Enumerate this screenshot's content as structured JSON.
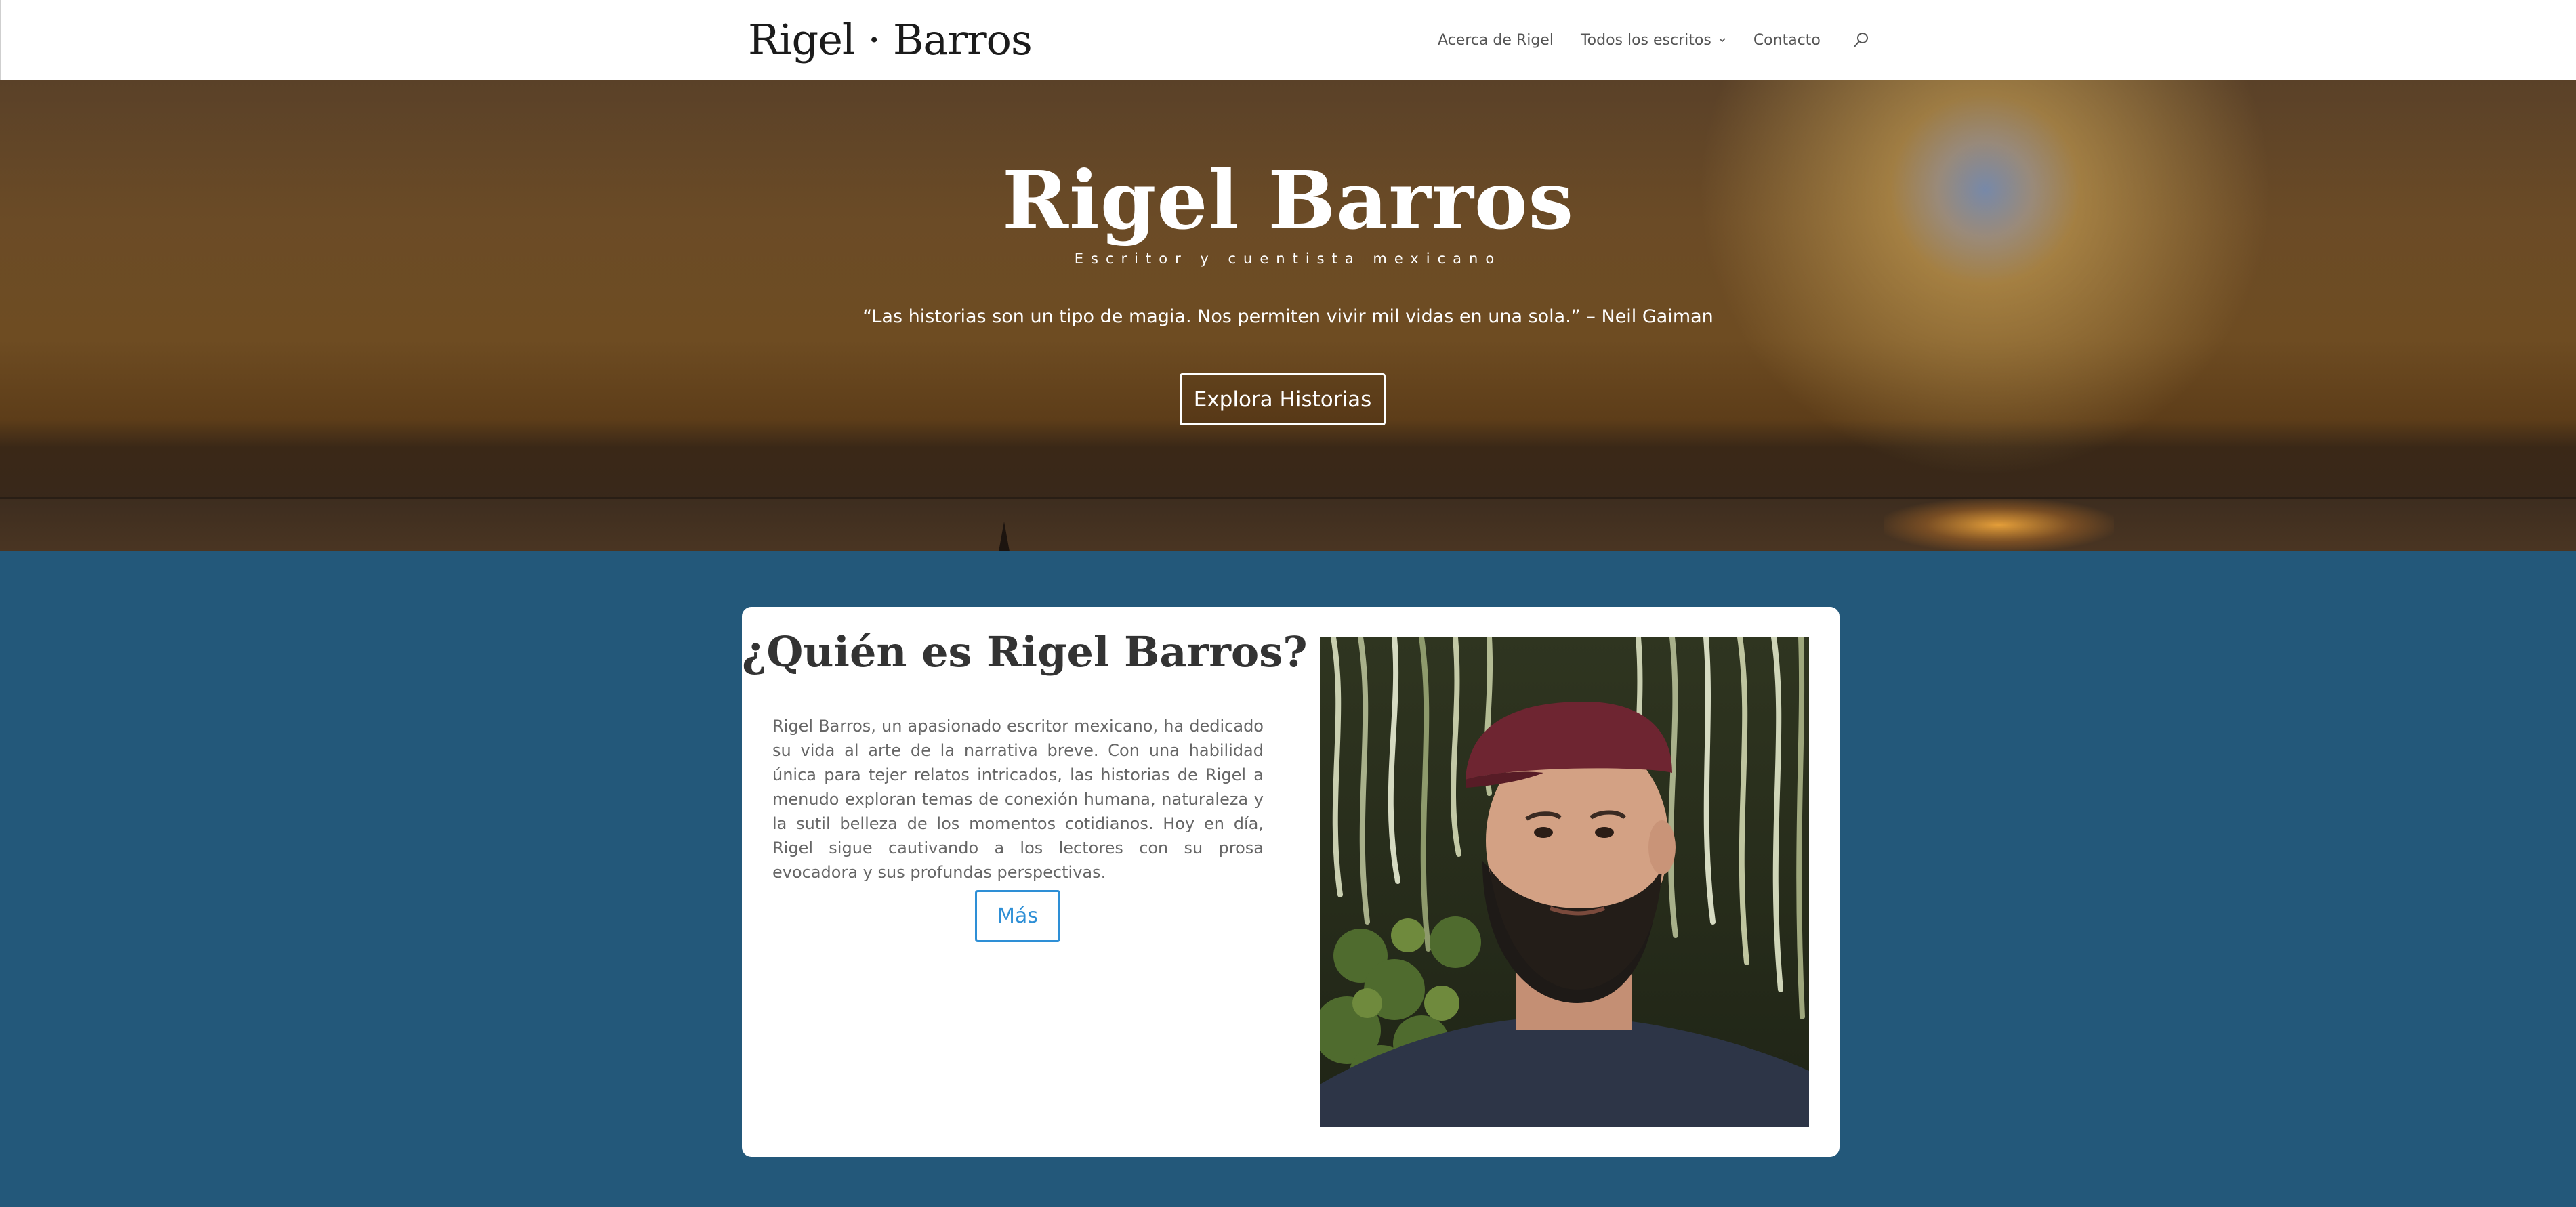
{
  "header": {
    "logo": "Rigel · Barros",
    "nav": [
      {
        "label": "Acerca de Rigel"
      },
      {
        "label": "Todos los escritos"
      },
      {
        "label": "Contacto"
      }
    ]
  },
  "hero": {
    "title": "Rigel Barros",
    "subtitle": "Escritor y cuentista mexicano",
    "quote": "“Las historias son un tipo de magia. Nos permiten vivir mil vidas en una sola.” – Neil Gaiman",
    "button_label": "Explora Historias"
  },
  "about": {
    "title": "¿Quién es Rigel Barros?",
    "text": "Rigel Barros, un apasionado escritor mexicano, ha dedicado su vida al arte de la narrativa breve. Con una habilidad única para tejer relatos intricados, las historias de Rigel a menudo exploran temas de conexión humana, naturaleza y la sutil belleza de los momentos cotidianos. Hoy en día, Rigel sigue cautivando a los lectores con su prosa evocadora y sus profundas perspectivas.",
    "button_label": "Más"
  },
  "colors": {
    "section_background": "#23587a",
    "accent": "#2e8fd6"
  }
}
